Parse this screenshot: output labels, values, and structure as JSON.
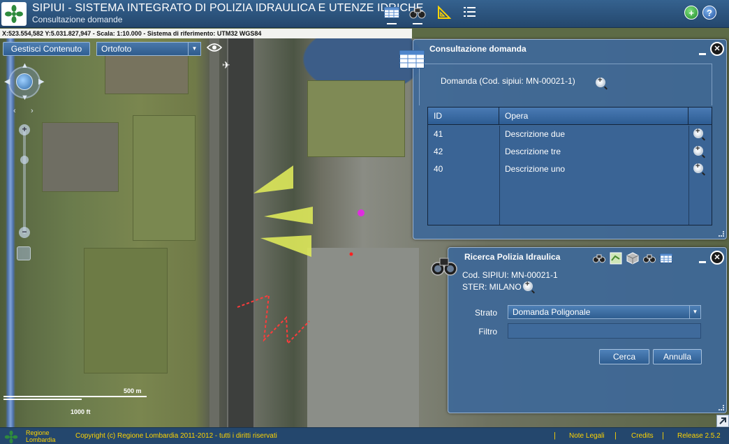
{
  "header": {
    "title": "SIPIUI - SISTEMA INTEGRATO DI POLIZIA IDRAULICA E UTENZE IDRICHE",
    "subtitle": "Consultazione domande",
    "tools": [
      "table-icon",
      "binoculars-icon",
      "ruler-icon",
      "list-icon"
    ],
    "add_button": "+",
    "help_button": "?"
  },
  "coords_bar": {
    "text": "X:523.554,582 Y:5.031.827,947 - Scala: 1:10.000 - Sistema di riferimento: UTM32 WGS84"
  },
  "toolbar": {
    "gestisci_label": "Gestisci Contenuto",
    "layer_selected": "Ortofoto"
  },
  "scale": {
    "metric": "500 m",
    "imperial": "1000 ft"
  },
  "consultazione": {
    "title": "Consultazione domanda",
    "domanda_label": "Domanda (Cod. sipiui: MN-00021-1)",
    "columns": [
      "ID",
      "Opera"
    ],
    "rows": [
      {
        "id": "41",
        "opera": "Descrizione due"
      },
      {
        "id": "42",
        "opera": "Descrizione tre"
      },
      {
        "id": "40",
        "opera": "Descrizione uno"
      }
    ]
  },
  "ricerca": {
    "title": "Ricerca Polizia Idraulica",
    "cod": "Cod. SIPIUI: MN-00021-1",
    "ster": "STER: MILANO",
    "strato_label": "Strato",
    "strato_value": "Domanda Poligonale",
    "filtro_label": "Filtro",
    "filtro_value": "",
    "cerca_label": "Cerca",
    "annulla_label": "Annulla"
  },
  "footer": {
    "region_line1": "Regione",
    "region_line2": "Lombardia",
    "copyright": "Copyright (c) Regione Lombardia 2011-2012 - tutti i diritti riservati",
    "sep": "|",
    "note_legali": "Note Legali",
    "credits": "Credits",
    "release": "Release 2.5.2"
  },
  "colors": {
    "header_bg": "#2a5078",
    "panel_bg": "#3e6898",
    "footer_text": "#ffd400"
  }
}
